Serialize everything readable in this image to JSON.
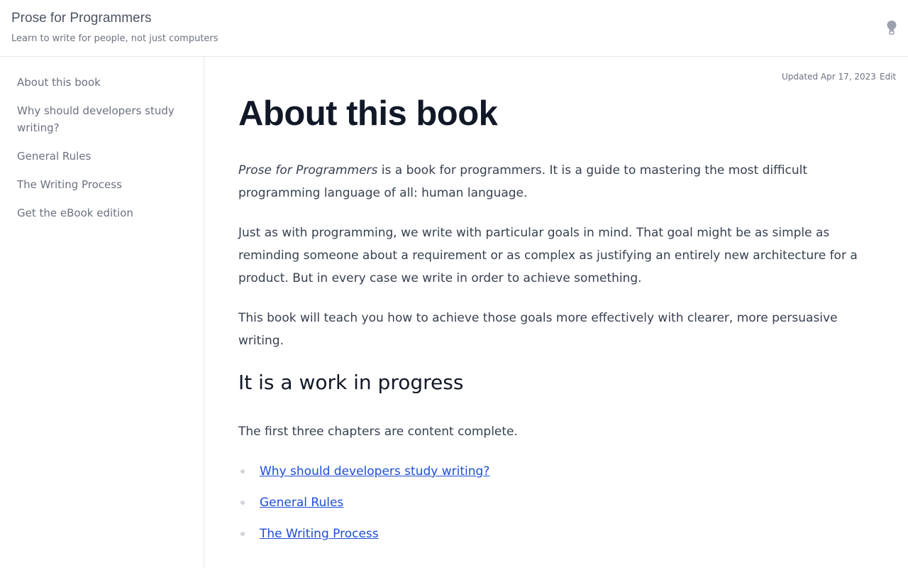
{
  "header": {
    "title": "Prose for Programmers",
    "tagline": "Learn to write for people, not just computers",
    "theme_icon": "lightbulb-icon"
  },
  "sidebar": {
    "items": [
      {
        "label": "About this book"
      },
      {
        "label": "Why should developers study writing?"
      },
      {
        "label": "General Rules"
      },
      {
        "label": "The Writing Process"
      },
      {
        "label": "Get the eBook edition"
      }
    ]
  },
  "meta": {
    "updated": "Updated Apr 17, 2023",
    "edit": "Edit"
  },
  "content": {
    "title": "About this book",
    "intro_emphasis": "Prose for Programmers",
    "intro_rest": " is a book for programmers. It is a guide to mastering the most difficult programming language of all: human language.",
    "paragraph2": "Just as with programming, we write with particular goals in mind. That goal might be as simple as reminding someone about a requirement or as complex as justifying an entirely new architecture for a product. But in every case we write in order to achieve something.",
    "paragraph3": "This book will teach you how to achieve those goals more effectively with clearer, more persuasive writing.",
    "section_title": "It is a work in progress",
    "section_text": "The first three chapters are content complete.",
    "links": [
      {
        "label": "Why should developers study writing?"
      },
      {
        "label": "General Rules"
      },
      {
        "label": "The Writing Process"
      }
    ]
  },
  "colors": {
    "link": "#1d4ed8",
    "heading": "#111827",
    "body": "#374151",
    "muted": "#6b7280",
    "border": "#e5e7eb"
  }
}
